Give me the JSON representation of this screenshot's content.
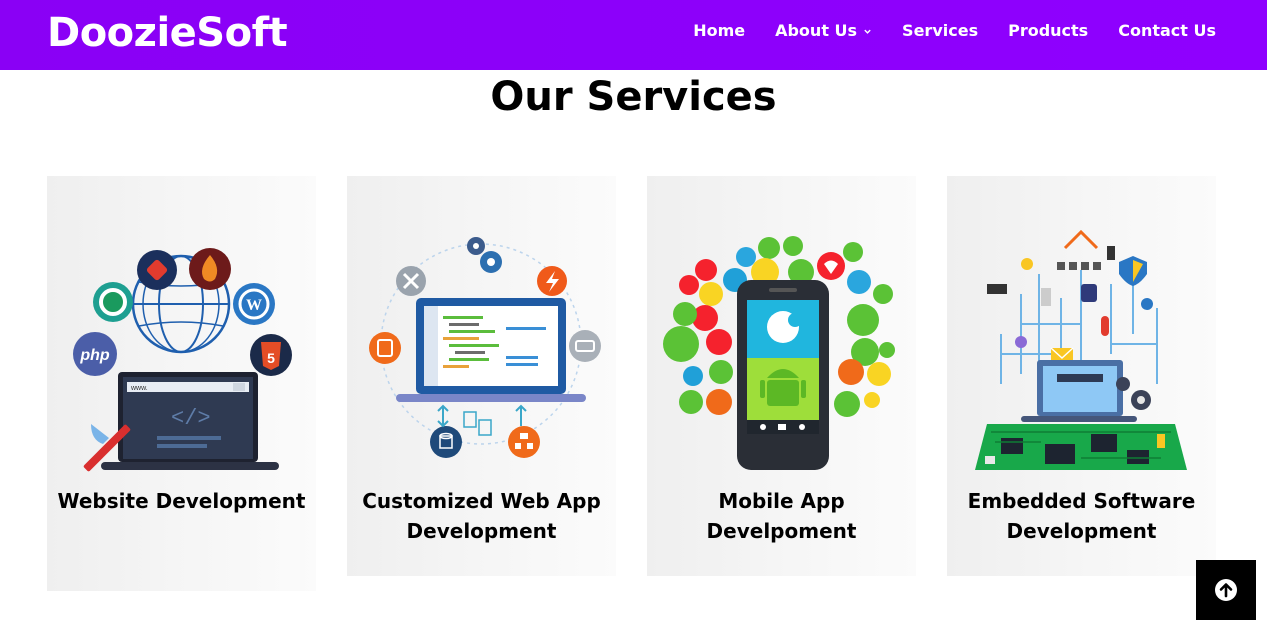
{
  "brand": "DoozieSoft",
  "nav": {
    "items": [
      "Home",
      "About Us",
      "Services",
      "Products",
      "Contact Us"
    ]
  },
  "section": {
    "title": "Our Services"
  },
  "services": [
    {
      "title": "Website Development",
      "icon": "website-development-illustration"
    },
    {
      "title": "Customized Web App Development",
      "icon": "web-app-development-illustration"
    },
    {
      "title": "Mobile App Develpoment",
      "icon": "mobile-app-illustration"
    },
    {
      "title": "Embedded Software Development",
      "icon": "embedded-software-illustration"
    }
  ],
  "colors": {
    "nav_bg": "#8f00ff",
    "card_bg": "#f4f4f4",
    "back_to_top_bg": "#000000"
  }
}
